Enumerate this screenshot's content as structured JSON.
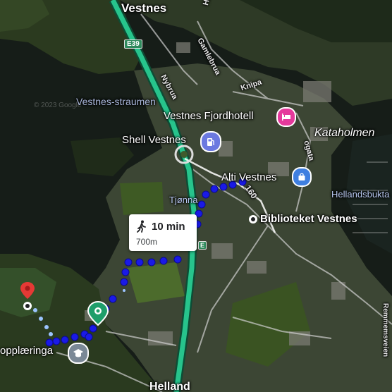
{
  "map": {
    "place_labels": {
      "vestnes": "Vestnes",
      "helland": "Helland",
      "kataholmen": "Kataholmen",
      "hellandsbukta": "Hellandsbukta",
      "tjonna": "Tjønna",
      "vestnes_straumen": "Vestnes-straumen"
    },
    "street_labels": {
      "nybrua": "Nybrua",
      "gamlebrua": "Gamlebrua",
      "knipa": "Knipa",
      "hagen": "Hagen",
      "ogata": "ogata",
      "rommen": "Remmemsveien",
      "road_160": "160"
    },
    "route_shield": "E39",
    "shield_2": "E",
    "pois": {
      "hotel": "Vestnes Fjordhotell",
      "shell": "Shell Vestnes",
      "alti": "Alti Vestnes",
      "library": "Biblioteket Vestnes",
      "school": "opplæringa"
    },
    "route_card": {
      "duration": "10 min",
      "distance": "700m"
    },
    "watermark": "© 2023 Google",
    "colors": {
      "route": "#1a1ae6",
      "highway": "#27c48c",
      "pin": "#e53935",
      "hotel_pin": "#e5399c",
      "shop_pin": "#3f7fe0",
      "gas_pin": "#6b79e0",
      "school_pin": "#7a8896",
      "dest_pin": "#1e9e6a"
    },
    "icons": [
      "walk-icon",
      "bed-icon",
      "gas-icon",
      "shopping-bag-icon",
      "school-icon",
      "place-pin-icon"
    ]
  }
}
